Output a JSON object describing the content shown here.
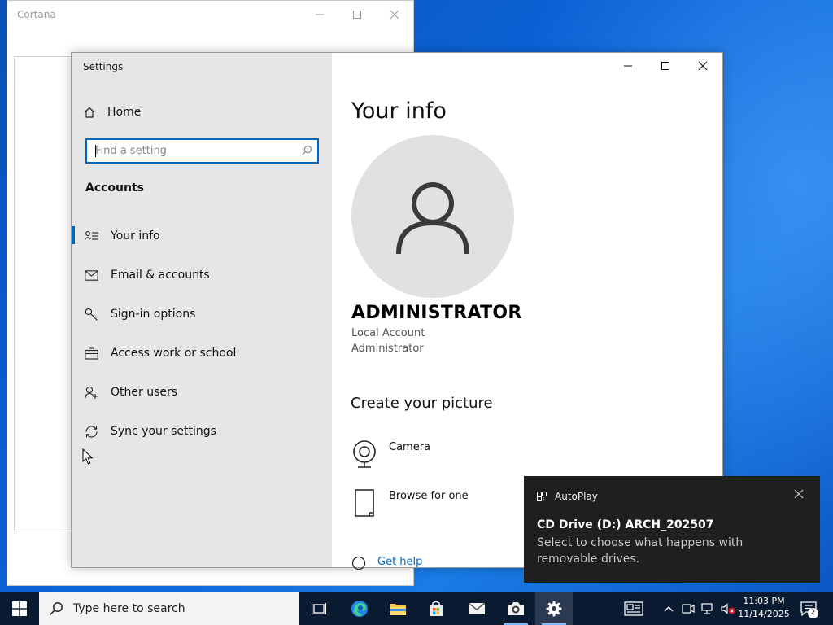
{
  "cortana": {
    "title": "Cortana"
  },
  "settings": {
    "title": "Settings",
    "sidebar": {
      "home_label": "Home",
      "search_placeholder": "Find a setting",
      "section": "Accounts",
      "items": [
        {
          "label": "Your info",
          "icon": "contact-card-icon",
          "active": true
        },
        {
          "label": "Email & accounts",
          "icon": "mail-icon"
        },
        {
          "label": "Sign-in options",
          "icon": "key-icon"
        },
        {
          "label": "Access work or school",
          "icon": "briefcase-icon"
        },
        {
          "label": "Other users",
          "icon": "add-person-icon"
        },
        {
          "label": "Sync your settings",
          "icon": "sync-icon"
        }
      ]
    },
    "main": {
      "title": "Your info",
      "user_name": "ADMINISTRATOR",
      "account_type": "Local Account",
      "account_role": "Administrator",
      "picture_heading": "Create your picture",
      "options": [
        {
          "label": "Camera",
          "icon": "camera-icon"
        },
        {
          "label": "Browse for one",
          "icon": "file-icon"
        }
      ],
      "help_label": "Get help"
    }
  },
  "toast": {
    "app": "AutoPlay",
    "headline": "CD Drive (D:) ARCH_202507",
    "body": "Select to choose what happens with removable drives."
  },
  "taskbar": {
    "search_placeholder": "Type here to search",
    "time": "11:03 PM",
    "date": "11/14/2025",
    "notification_count": "2",
    "accent": "#0067c0"
  }
}
